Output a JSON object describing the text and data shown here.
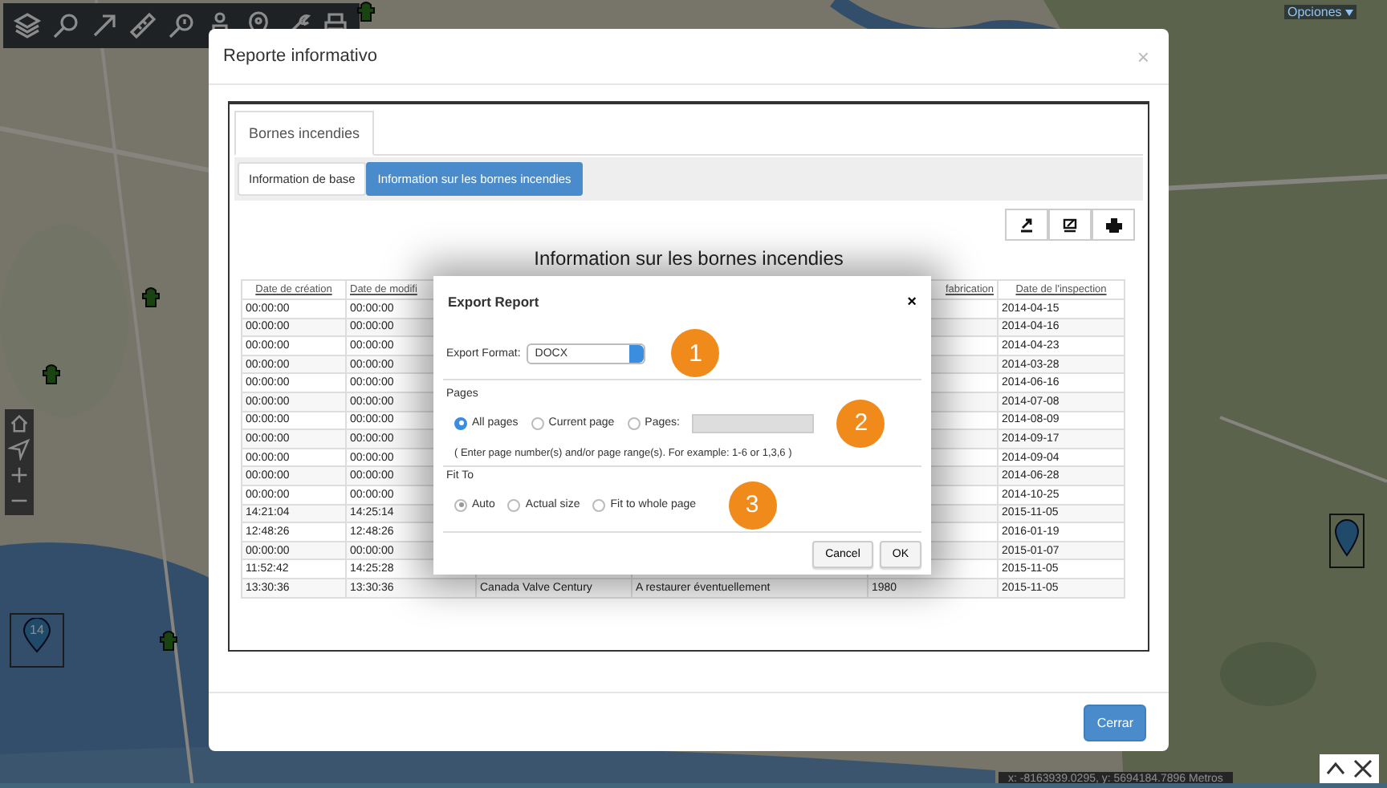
{
  "map": {
    "options_menu": "Opciones",
    "cluster_count": "14",
    "coordinates": "x: -8163939.0295, y: 5694184.7896 Metros"
  },
  "modal": {
    "title": "Reporte informativo",
    "close": "×",
    "tabs": [
      {
        "label": "Bornes incendies",
        "selected": true
      }
    ],
    "subtabs": [
      {
        "label": "Information de base",
        "selected": false
      },
      {
        "label": "Information sur les bornes incendies",
        "selected": true
      }
    ],
    "report_title": "Information sur les bornes incendies",
    "table": {
      "columns": {
        "column_1": "Date de création",
        "column_2": "Date de modifi",
        "column_5": "fabrication",
        "column_6": "Date de l'inspection"
      },
      "rows": [
        {
          "column_1": "00:00:00",
          "column_2": "00:00:00",
          "column_6": "2014-04-15"
        },
        {
          "column_1": "00:00:00",
          "column_2": "00:00:00",
          "column_6": "2014-04-16"
        },
        {
          "column_1": "00:00:00",
          "column_2": "00:00:00",
          "column_6": "2014-04-23"
        },
        {
          "column_1": "00:00:00",
          "column_2": "00:00:00",
          "column_6": "2014-03-28"
        },
        {
          "column_1": "00:00:00",
          "column_2": "00:00:00",
          "column_6": "2014-06-16"
        },
        {
          "column_1": "00:00:00",
          "column_2": "00:00:00",
          "column_6": "2014-07-08"
        },
        {
          "column_1": "00:00:00",
          "column_2": "00:00:00",
          "column_6": "2014-08-09"
        },
        {
          "column_1": "00:00:00",
          "column_2": "00:00:00",
          "column_6": "2014-09-17"
        },
        {
          "column_1": "00:00:00",
          "column_2": "00:00:00",
          "column_6": "2014-09-04"
        },
        {
          "column_1": "00:00:00",
          "column_2": "00:00:00",
          "column_6": "2014-06-28"
        },
        {
          "column_1": "00:00:00",
          "column_2": "00:00:00",
          "column_6": "2014-10-25"
        },
        {
          "column_1": "14:21:04",
          "column_2": "14:25:14",
          "column_6": "2015-11-05"
        },
        {
          "column_1": "12:48:26",
          "column_2": "12:48:26",
          "column_6": "2016-01-19"
        },
        {
          "column_1": "00:00:00",
          "column_2": "00:00:00",
          "column_6": "2015-01-07"
        },
        {
          "column_1": "11:52:42",
          "column_2": "14:25:28",
          "column_6": "2015-11-05"
        },
        {
          "column_1": "13:30:36",
          "column_2": "13:30:36",
          "column_3": "Canada Valve Century",
          "column_4": "A restaurer éventuellement",
          "column_5": "1980",
          "column_6": "2015-11-05"
        }
      ]
    },
    "close_button": "Cerrar"
  },
  "export_dialog": {
    "title": "Export Report",
    "close": "×",
    "format_label": "Export Format:",
    "format_value": "DOCX",
    "step_1": "1",
    "pages_label": "Pages",
    "pages_options": [
      {
        "label": "All pages",
        "selected": true
      },
      {
        "label": "Current page",
        "selected": false
      },
      {
        "label": "Pages:",
        "selected": false
      }
    ],
    "pages_hint": "( Enter page number(s) and/or page range(s). For example: 1-6 or 1,3,6 )",
    "step_2": "2",
    "fit_label": "Fit To",
    "fit_options": [
      {
        "label": "Auto",
        "selected": true
      },
      {
        "label": "Actual size",
        "selected": false
      },
      {
        "label": "Fit to whole page",
        "selected": false
      }
    ],
    "step_3": "3",
    "buttons": [
      "Cancel",
      "OK"
    ]
  }
}
